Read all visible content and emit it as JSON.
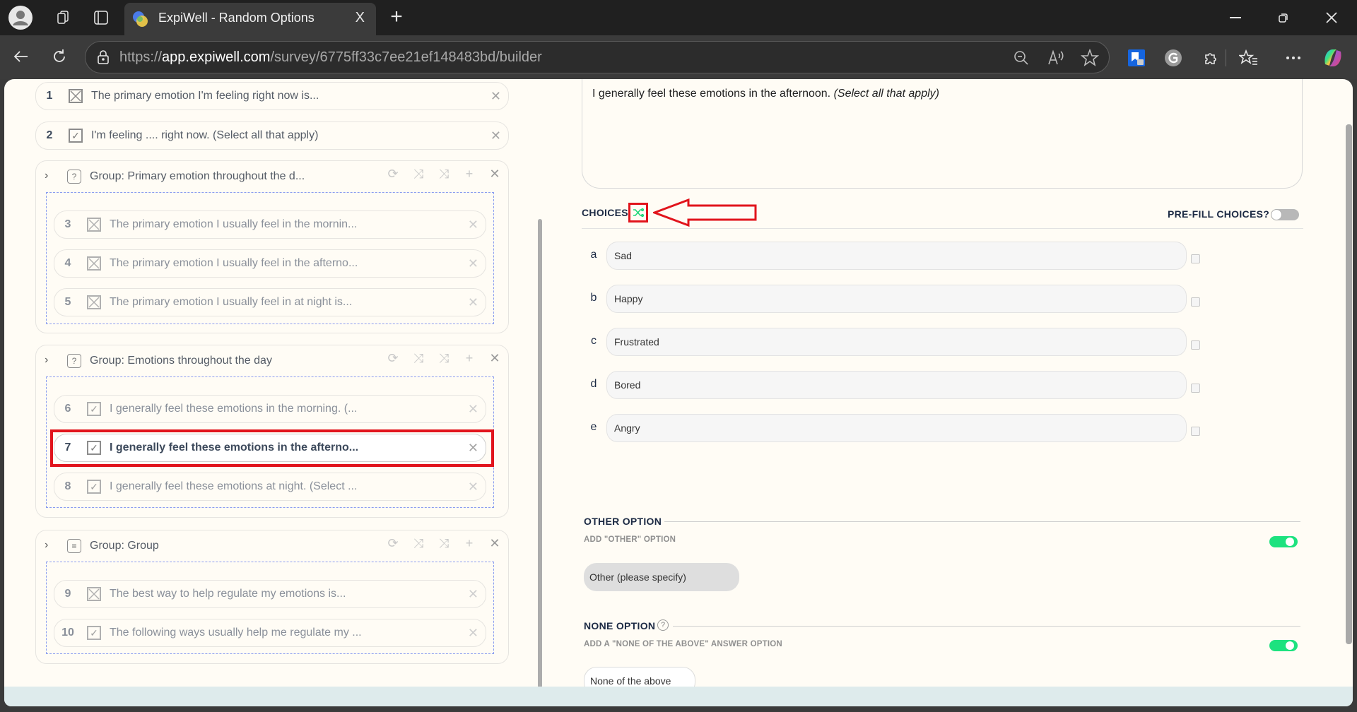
{
  "browser": {
    "tab_title": "ExpiWell - Random Options",
    "url_scheme": "https://",
    "url_host": "app.expiwell.com",
    "url_path": "/survey/6775ff33c7ee21ef148483bd/builder",
    "new_tab": "+",
    "tab_close": "X"
  },
  "questions_top": [
    {
      "num": "1",
      "type": "single-choice",
      "text": "The primary emotion I'm feeling right now is..."
    },
    {
      "num": "2",
      "type": "multi-choice",
      "text": "I'm feeling .... right now. (Select all that apply)"
    }
  ],
  "groups": [
    {
      "title": "Group: Primary emotion throughout the d...",
      "icon": "question-icon",
      "items": [
        {
          "num": "3",
          "type": "single-choice",
          "text": "The primary emotion I usually feel in the mornin..."
        },
        {
          "num": "4",
          "type": "single-choice",
          "text": "The primary emotion I usually feel in the afterno..."
        },
        {
          "num": "5",
          "type": "single-choice",
          "text": "The primary emotion I usually feel in at night is..."
        }
      ]
    },
    {
      "title": "Group: Emotions throughout the day",
      "icon": "question-icon",
      "items": [
        {
          "num": "6",
          "type": "multi-choice",
          "text": "I generally feel these emotions in the morning. (..."
        },
        {
          "num": "7",
          "type": "multi-choice",
          "text": "I generally feel these emotions in the afterno...",
          "selected": true
        },
        {
          "num": "8",
          "type": "multi-choice",
          "text": "I generally feel these emotions at night. (Select ..."
        }
      ]
    },
    {
      "title": "Group: Group",
      "icon": "list-icon",
      "items": [
        {
          "num": "9",
          "type": "single-choice",
          "text": "The best way to help regulate my emotions is..."
        },
        {
          "num": "10",
          "type": "multi-choice",
          "text": "The following ways usually help me regulate my ..."
        }
      ]
    }
  ],
  "editor": {
    "question_text": "I generally feel these emotions in the afternoon.",
    "question_hint": "(Select all that apply)",
    "choices_label": "CHOICES",
    "prefill_label": "PRE-FILL CHOICES?",
    "prefill_on": false,
    "choices": [
      {
        "letter": "a",
        "value": "Sad",
        "checked": false
      },
      {
        "letter": "b",
        "value": "Happy",
        "checked": false
      },
      {
        "letter": "c",
        "value": "Frustrated",
        "checked": false
      },
      {
        "letter": "d",
        "value": "Bored",
        "checked": false
      },
      {
        "letter": "e",
        "value": "Angry",
        "checked": false
      }
    ],
    "other_section": "OTHER OPTION",
    "other_sub": "ADD \"OTHER\" OPTION",
    "other_on": true,
    "other_value": "Other (please specify)",
    "none_section": "NONE OPTION",
    "none_sub": "ADD A \"NONE OF THE ABOVE\" ANSWER OPTION",
    "none_on": true,
    "none_value": "None of the above"
  },
  "colors": {
    "accent_green": "#1de27f",
    "highlight_red": "#e1141c",
    "page_bg": "#fffcf5"
  }
}
